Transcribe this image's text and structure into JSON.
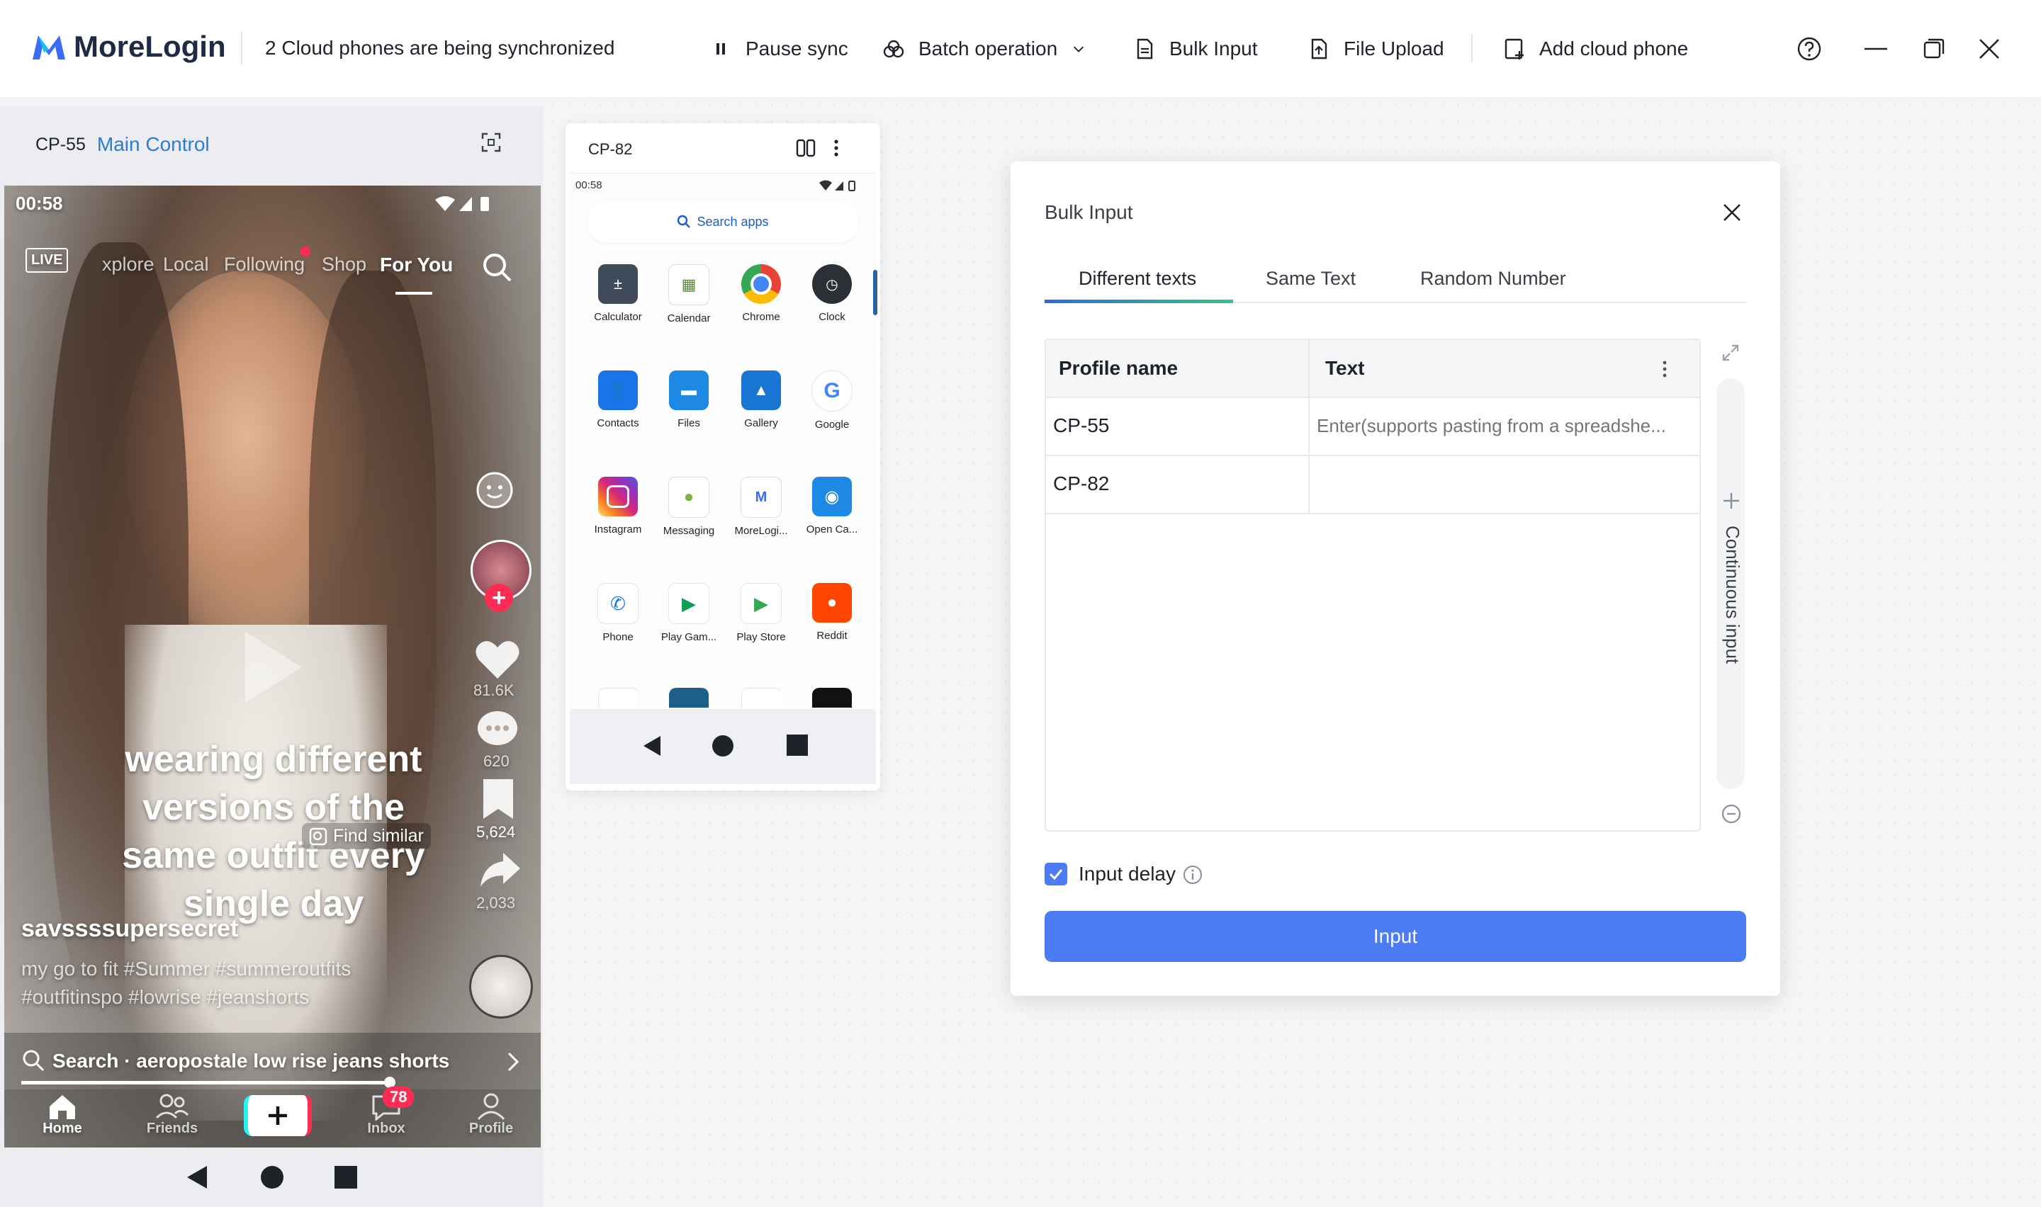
{
  "header": {
    "brand": "MoreLogin",
    "sync_status": "2 Cloud phones are being synchronized",
    "pause_sync": "Pause sync",
    "batch_operation": "Batch operation",
    "bulk_input": "Bulk Input",
    "file_upload": "File Upload",
    "add_cloud_phone": "Add cloud phone"
  },
  "main_phone": {
    "name": "CP-55",
    "role": "Main Control",
    "time": "00:58",
    "tabs": [
      "LIVE",
      "xplore",
      "Local",
      "Following",
      "Shop",
      "For You"
    ],
    "caption_lines": [
      "wearing different",
      "versions of the",
      "same outfit every",
      "single day"
    ],
    "find_similar": "Find similar",
    "username": "savssssupersecret",
    "hashtags_1": "my go to fit #Summer #summeroutfits",
    "hashtags_2": "#outfitinspo #lowrise #jeanshorts",
    "likes": "81.6K",
    "comments": "620",
    "saves": "5,624",
    "shares": "2,033",
    "search_text": "Search · aeropostale low rise jeans shorts",
    "nav": {
      "home": "Home",
      "friends": "Friends",
      "inbox": "Inbox",
      "inbox_badge": "78",
      "profile": "Profile"
    }
  },
  "second_phone": {
    "name": "CP-82",
    "time": "00:58",
    "search_placeholder": "Search apps",
    "apps": [
      "Calculator",
      "Calendar",
      "Chrome",
      "Clock",
      "Contacts",
      "Files",
      "Gallery",
      "Google",
      "Instagram",
      "Messaging",
      "MoreLogi...",
      "Open Ca...",
      "Phone",
      "Play Gam...",
      "Play Store",
      "Reddit"
    ]
  },
  "dialog": {
    "title": "Bulk Input",
    "tabs": [
      "Different texts",
      "Same Text",
      "Random Number"
    ],
    "active_tab": "Different texts",
    "columns": [
      "Profile name",
      "Text"
    ],
    "rows": [
      {
        "profile": "CP-55",
        "text": "",
        "placeholder": "Enter(supports pasting from a spreadshe..."
      },
      {
        "profile": "CP-82",
        "text": ""
      }
    ],
    "continuous_input": "Continuous input",
    "input_delay_label": "Input delay",
    "input_delay_checked": true,
    "input_button": "Input"
  },
  "colors": {
    "accent": "#4b7bf5",
    "link": "#2d7bd6",
    "badge": "#fe2c55"
  }
}
